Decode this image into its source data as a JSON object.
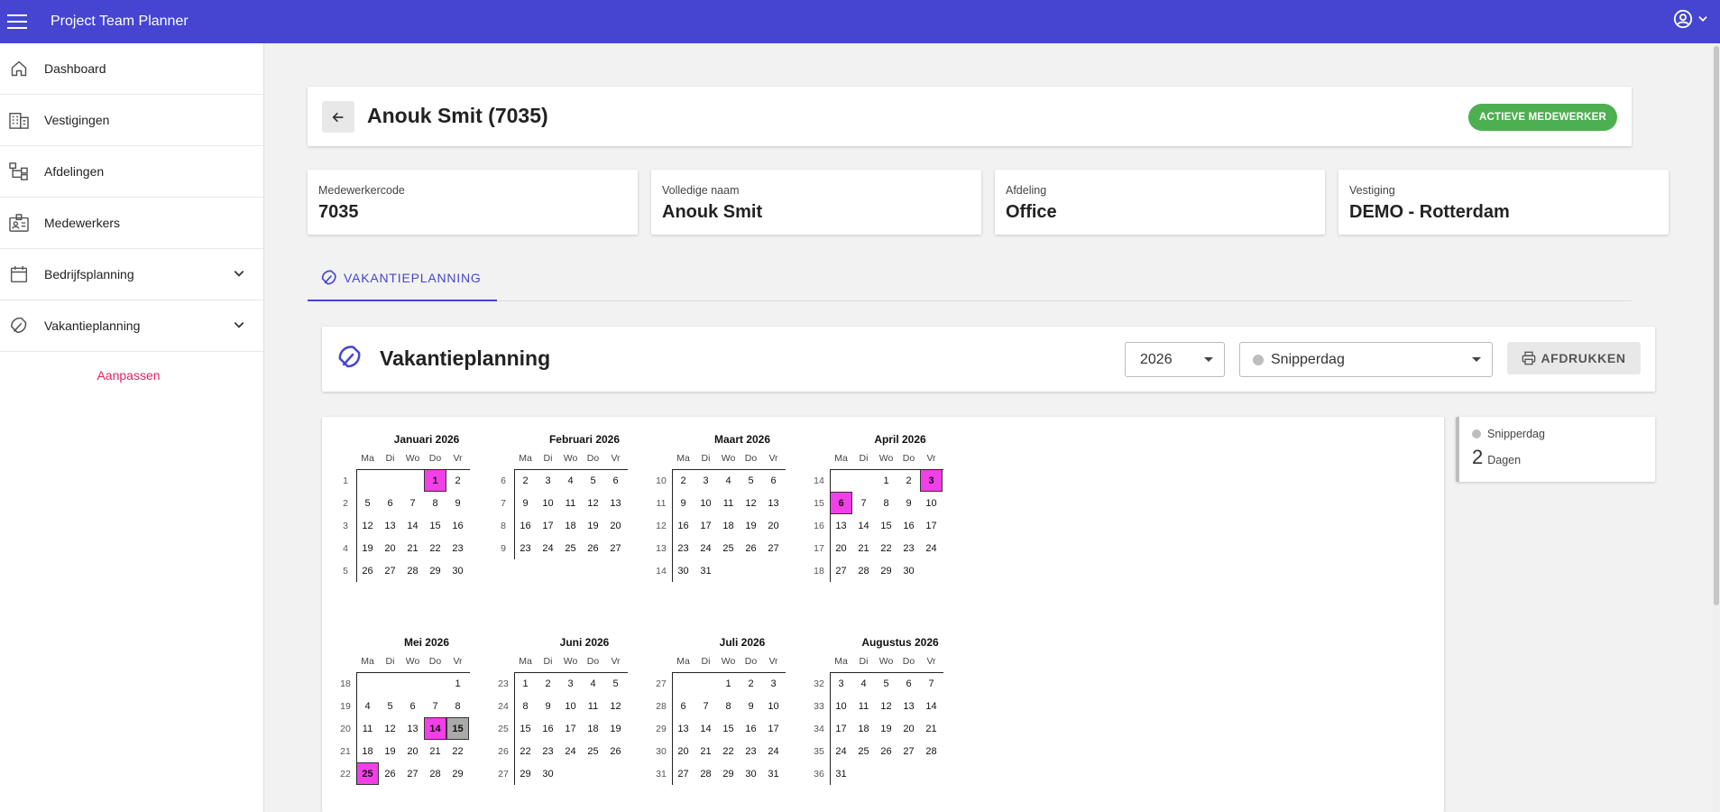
{
  "app": {
    "title": "Project Team Planner"
  },
  "sidebar": {
    "items": [
      {
        "label": "Dashboard",
        "icon": "home-icon"
      },
      {
        "label": "Vestigingen",
        "icon": "building-icon"
      },
      {
        "label": "Afdelingen",
        "icon": "org-chart-icon"
      },
      {
        "label": "Medewerkers",
        "icon": "badge-icon"
      },
      {
        "label": "Bedrijfsplanning",
        "icon": "calendar-icon",
        "expandable": true
      },
      {
        "label": "Vakantieplanning",
        "icon": "umbrella-icon",
        "expandable": true
      }
    ],
    "customize_label": "Aanpassen"
  },
  "employee": {
    "title": "Anouk Smit (7035)",
    "status_badge": "ACTIEVE MEDEWERKER",
    "fields": [
      {
        "label": "Medewerkercode",
        "value": "7035"
      },
      {
        "label": "Volledige naam",
        "value": "Anouk Smit"
      },
      {
        "label": "Afdeling",
        "value": "Office"
      },
      {
        "label": "Vestiging",
        "value": "DEMO - Rotterdam"
      }
    ]
  },
  "tab": {
    "label": "VAKANTIEPLANNING"
  },
  "planning": {
    "title": "Vakantieplanning",
    "year": "2026",
    "type": "Snipperdag",
    "print_label": "AFDRUKKEN"
  },
  "legend": {
    "type": "Snipperdag",
    "count": "2",
    "unit": "Dagen"
  },
  "colors": {
    "brand": "#4545d2",
    "snipperdag": "#f33fe8",
    "other": "#aaaaaa",
    "active": "#4caf50",
    "accent": "#e0245e"
  },
  "calendar": {
    "day_headers": [
      "Ma",
      "Di",
      "Wo",
      "Do",
      "Vr"
    ],
    "months": [
      {
        "title": "Januari 2026",
        "weeks": [
          {
            "wk": "1",
            "days": [
              "",
              "",
              "",
              "1",
              "2"
            ]
          },
          {
            "wk": "2",
            "days": [
              "5",
              "6",
              "7",
              "8",
              "9"
            ]
          },
          {
            "wk": "3",
            "days": [
              "12",
              "13",
              "14",
              "15",
              "16"
            ]
          },
          {
            "wk": "4",
            "days": [
              "19",
              "20",
              "21",
              "22",
              "23"
            ]
          },
          {
            "wk": "5",
            "days": [
              "26",
              "27",
              "28",
              "29",
              "30"
            ]
          }
        ],
        "highlights": {
          "1": "snip"
        }
      },
      {
        "title": "Februari 2026",
        "weeks": [
          {
            "wk": "6",
            "days": [
              "2",
              "3",
              "4",
              "5",
              "6"
            ]
          },
          {
            "wk": "7",
            "days": [
              "9",
              "10",
              "11",
              "12",
              "13"
            ]
          },
          {
            "wk": "8",
            "days": [
              "16",
              "17",
              "18",
              "19",
              "20"
            ]
          },
          {
            "wk": "9",
            "days": [
              "23",
              "24",
              "25",
              "26",
              "27"
            ]
          }
        ],
        "highlights": {}
      },
      {
        "title": "Maart 2026",
        "weeks": [
          {
            "wk": "10",
            "days": [
              "2",
              "3",
              "4",
              "5",
              "6"
            ]
          },
          {
            "wk": "11",
            "days": [
              "9",
              "10",
              "11",
              "12",
              "13"
            ]
          },
          {
            "wk": "12",
            "days": [
              "16",
              "17",
              "18",
              "19",
              "20"
            ]
          },
          {
            "wk": "13",
            "days": [
              "23",
              "24",
              "25",
              "26",
              "27"
            ]
          },
          {
            "wk": "14",
            "days": [
              "30",
              "31",
              "",
              "",
              ""
            ]
          }
        ],
        "highlights": {}
      },
      {
        "title": "April 2026",
        "weeks": [
          {
            "wk": "14",
            "days": [
              "",
              "",
              "1",
              "2",
              "3"
            ]
          },
          {
            "wk": "15",
            "days": [
              "6",
              "7",
              "8",
              "9",
              "10"
            ]
          },
          {
            "wk": "16",
            "days": [
              "13",
              "14",
              "15",
              "16",
              "17"
            ]
          },
          {
            "wk": "17",
            "days": [
              "20",
              "21",
              "22",
              "23",
              "24"
            ]
          },
          {
            "wk": "18",
            "days": [
              "27",
              "28",
              "29",
              "30",
              ""
            ]
          }
        ],
        "highlights": {
          "3": "snip",
          "6": "snip"
        }
      },
      {
        "title": "Mei 2026",
        "weeks": [
          {
            "wk": "18",
            "days": [
              "",
              "",
              "",
              "",
              "1"
            ]
          },
          {
            "wk": "19",
            "days": [
              "4",
              "5",
              "6",
              "7",
              "8"
            ]
          },
          {
            "wk": "20",
            "days": [
              "11",
              "12",
              "13",
              "14",
              "15"
            ]
          },
          {
            "wk": "21",
            "days": [
              "18",
              "19",
              "20",
              "21",
              "22"
            ]
          },
          {
            "wk": "22",
            "days": [
              "25",
              "26",
              "27",
              "28",
              "29"
            ]
          }
        ],
        "highlights": {
          "14": "snip",
          "15": "grey",
          "25": "snip"
        }
      },
      {
        "title": "Juni 2026",
        "weeks": [
          {
            "wk": "23",
            "days": [
              "1",
              "2",
              "3",
              "4",
              "5"
            ]
          },
          {
            "wk": "24",
            "days": [
              "8",
              "9",
              "10",
              "11",
              "12"
            ]
          },
          {
            "wk": "25",
            "days": [
              "15",
              "16",
              "17",
              "18",
              "19"
            ]
          },
          {
            "wk": "26",
            "days": [
              "22",
              "23",
              "24",
              "25",
              "26"
            ]
          },
          {
            "wk": "27",
            "days": [
              "29",
              "30",
              "",
              "",
              ""
            ]
          }
        ],
        "highlights": {}
      },
      {
        "title": "Juli 2026",
        "weeks": [
          {
            "wk": "27",
            "days": [
              "",
              "",
              "1",
              "2",
              "3"
            ]
          },
          {
            "wk": "28",
            "days": [
              "6",
              "7",
              "8",
              "9",
              "10"
            ]
          },
          {
            "wk": "29",
            "days": [
              "13",
              "14",
              "15",
              "16",
              "17"
            ]
          },
          {
            "wk": "30",
            "days": [
              "20",
              "21",
              "22",
              "23",
              "24"
            ]
          },
          {
            "wk": "31",
            "days": [
              "27",
              "28",
              "29",
              "30",
              "31"
            ]
          }
        ],
        "highlights": {}
      },
      {
        "title": "Augustus 2026",
        "weeks": [
          {
            "wk": "32",
            "days": [
              "3",
              "4",
              "5",
              "6",
              "7"
            ]
          },
          {
            "wk": "33",
            "days": [
              "10",
              "11",
              "12",
              "13",
              "14"
            ]
          },
          {
            "wk": "34",
            "days": [
              "17",
              "18",
              "19",
              "20",
              "21"
            ]
          },
          {
            "wk": "35",
            "days": [
              "24",
              "25",
              "26",
              "27",
              "28"
            ]
          },
          {
            "wk": "36",
            "days": [
              "31",
              "",
              "",
              "",
              ""
            ]
          }
        ],
        "highlights": {}
      }
    ]
  }
}
